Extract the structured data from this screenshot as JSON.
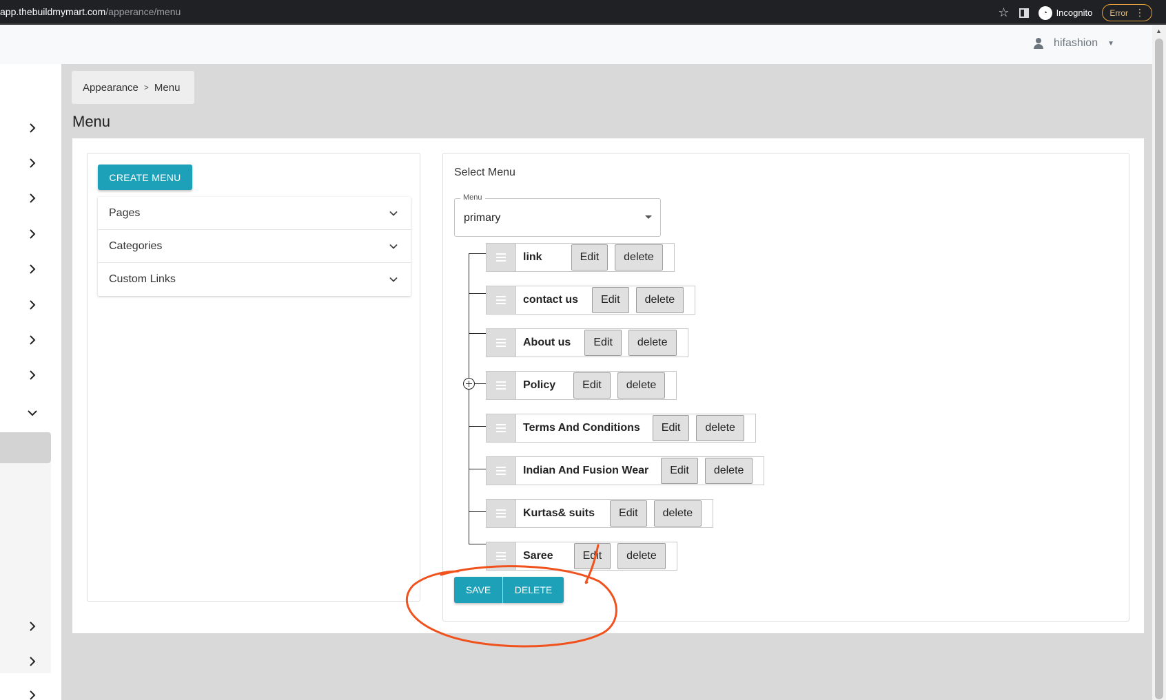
{
  "browser": {
    "url_host": "app.thebuildmymart.com",
    "url_path": "/apperance/menu",
    "incognito_label": "Incognito",
    "error_label": "Error"
  },
  "header": {
    "username": "hifashion"
  },
  "breadcrumb": {
    "parent": "Appearance",
    "separator": ">",
    "current": "Menu"
  },
  "page_title": "Menu",
  "left_panel": {
    "create_button": "CREATE MENU",
    "accordion": [
      {
        "label": "Pages"
      },
      {
        "label": "Categories"
      },
      {
        "label": "Custom Links"
      }
    ]
  },
  "right_panel": {
    "select_label": "Select Menu",
    "menu_field": {
      "legend": "Menu",
      "value": "primary"
    },
    "items": [
      {
        "label": "link",
        "edit": "Edit",
        "delete": "delete"
      },
      {
        "label": "contact us",
        "edit": "Edit",
        "delete": "delete"
      },
      {
        "label": "About us",
        "edit": "Edit",
        "delete": "delete"
      },
      {
        "label": "Policy",
        "edit": "Edit",
        "delete": "delete"
      },
      {
        "label": "Terms And Conditions",
        "edit": "Edit",
        "delete": "delete"
      },
      {
        "label": "Indian And Fusion Wear",
        "edit": "Edit",
        "delete": "delete"
      },
      {
        "label": "Kurtas& suits",
        "edit": "Edit",
        "delete": "delete"
      },
      {
        "label": "Saree",
        "edit": "Edit",
        "delete": "delete"
      }
    ],
    "save_button": "SAVE",
    "delete_button": "DELETE"
  },
  "colors": {
    "primary": "#1da1b8",
    "annotation": "#f0521e"
  }
}
